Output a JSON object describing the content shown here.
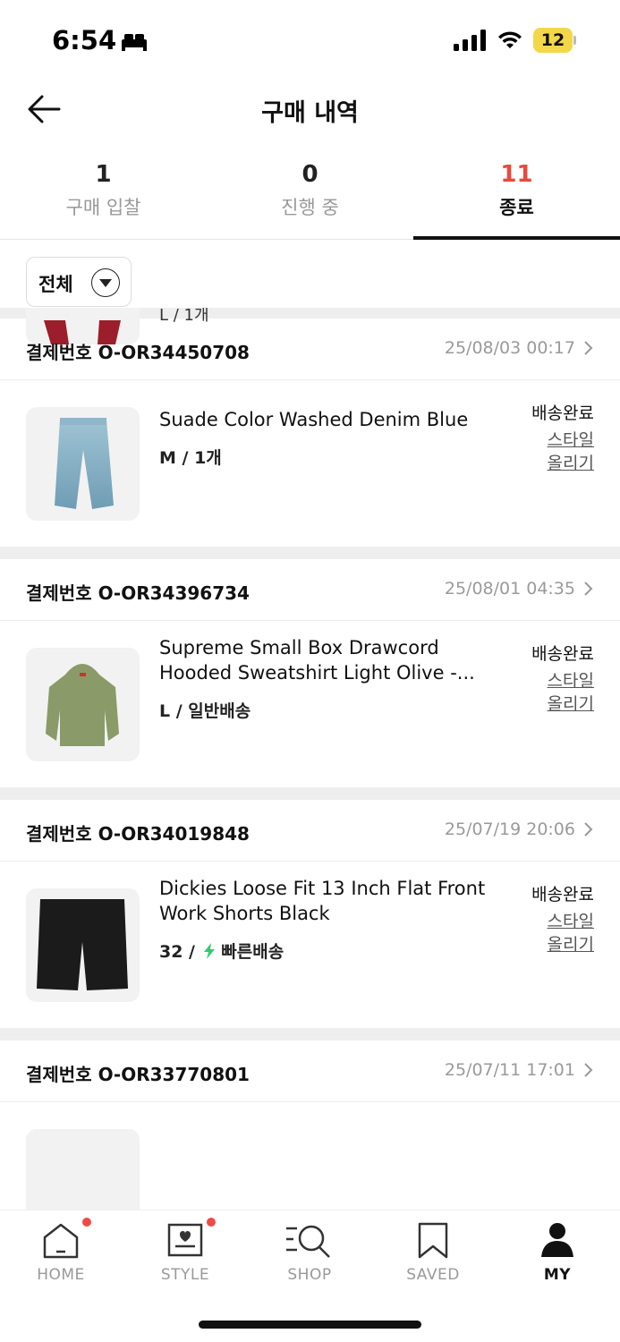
{
  "status_bar": {
    "time": "6:54",
    "battery": "12"
  },
  "header": {
    "title": "구매 내역"
  },
  "tabs": [
    {
      "count": "1",
      "label": "구매 입찰"
    },
    {
      "count": "0",
      "label": "진행 중"
    },
    {
      "count": "11",
      "label": "종료"
    }
  ],
  "filter": {
    "label": "전체"
  },
  "peek": {
    "meta": "L / 1개"
  },
  "orders": [
    {
      "order_label": "결제번호 O-OR34450708",
      "date": "25/08/03 00:17",
      "name": "Suade Color Washed Denim Blue",
      "option": "M / 1개",
      "status": "배송완료",
      "style_link": "스타일 올리기"
    },
    {
      "order_label": "결제번호 O-OR34396734",
      "date": "25/08/01 04:35",
      "name": "Supreme Small Box Drawcord Hooded Sweatshirt Light Olive -...",
      "option": "L / 일반배송",
      "status": "배송완료",
      "style_link": "스타일 올리기"
    },
    {
      "order_label": "결제번호 O-OR34019848",
      "date": "25/07/19 20:06",
      "name": "Dickies Loose Fit 13 Inch Flat Front Work Shorts Black",
      "option_size": "32 /",
      "option_ship": "빠른배송",
      "status": "배송완료",
      "style_link": "스타일 올리기"
    },
    {
      "order_label": "결제번호 O-OR33770801",
      "date": "25/07/11 17:01"
    }
  ],
  "bottom_nav": [
    {
      "label": "HOME",
      "icon": "home-icon"
    },
    {
      "label": "STYLE",
      "icon": "style-icon"
    },
    {
      "label": "SHOP",
      "icon": "shop-search-icon"
    },
    {
      "label": "SAVED",
      "icon": "bookmark-icon"
    },
    {
      "label": "MY",
      "icon": "profile-icon"
    }
  ],
  "colors": {
    "accent": "#e8493e",
    "fast_delivery": "#2ecc71",
    "notification_dot": "#ef4b45"
  }
}
